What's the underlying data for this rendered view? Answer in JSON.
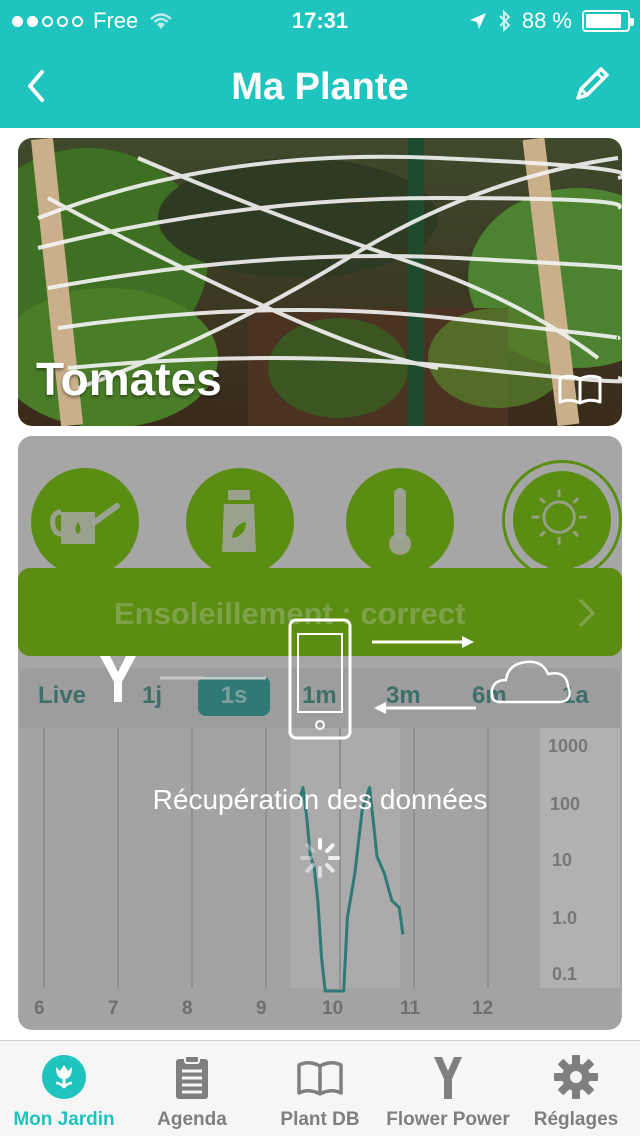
{
  "status_bar": {
    "carrier": "Free",
    "time": "17:31",
    "battery": "88 %",
    "battery_level": 0.88,
    "signal_bars": 2
  },
  "nav": {
    "title": "Ma Plante",
    "back_icon": "chevron-left-icon",
    "edit_icon": "pencil-icon"
  },
  "plant": {
    "name": "Tomates",
    "info_icon": "book-icon"
  },
  "sensors": [
    {
      "name": "watering-can-icon"
    },
    {
      "name": "fertilizer-icon"
    },
    {
      "name": "thermometer-icon"
    },
    {
      "name": "sun-icon",
      "selected": true
    }
  ],
  "status": {
    "text": "Ensoleillement : correct"
  },
  "ranges": {
    "items": [
      "Live",
      "1j",
      "1s",
      "1m",
      "3m",
      "6m",
      "1a"
    ],
    "selected": "1s"
  },
  "chart_data": {
    "type": "line",
    "y_scale": "log",
    "y_ticks": [
      "1000",
      "100",
      "10",
      "1.0",
      "0.1"
    ],
    "x_ticks": [
      "6",
      "7",
      "8",
      "9",
      "10",
      "11",
      "12"
    ],
    "series": [
      {
        "points": [
          [
            9.45,
            120
          ],
          [
            9.5,
            200
          ],
          [
            9.55,
            60
          ],
          [
            9.6,
            12
          ],
          [
            9.65,
            8
          ],
          [
            9.7,
            2
          ],
          [
            9.75,
            0.2
          ],
          [
            9.8,
            0.05
          ],
          [
            9.9,
            0.05
          ],
          [
            10.0,
            0.05
          ],
          [
            10.05,
            0.05
          ],
          [
            10.1,
            1
          ],
          [
            10.2,
            6
          ],
          [
            10.3,
            80
          ],
          [
            10.4,
            200
          ],
          [
            10.45,
            50
          ],
          [
            10.5,
            12
          ],
          [
            10.6,
            6
          ],
          [
            10.7,
            2
          ],
          [
            10.8,
            1.5
          ],
          [
            10.85,
            0.5
          ]
        ]
      }
    ]
  },
  "overlay": {
    "message": "Récupération des données"
  },
  "tabbar": {
    "items": [
      {
        "label": "Mon Jardin",
        "icon": "flower-icon",
        "active": true
      },
      {
        "label": "Agenda",
        "icon": "clipboard-icon",
        "active": false
      },
      {
        "label": "Plant DB",
        "icon": "book-icon",
        "active": false
      },
      {
        "label": "Flower Power",
        "icon": "sensor-y-icon",
        "active": false
      },
      {
        "label": "Réglages",
        "icon": "gear-icon",
        "active": false
      }
    ]
  },
  "colors": {
    "accent": "#1fc4bf",
    "sensor_green": "#5b8d12",
    "chart_line": "#2f7a76"
  }
}
